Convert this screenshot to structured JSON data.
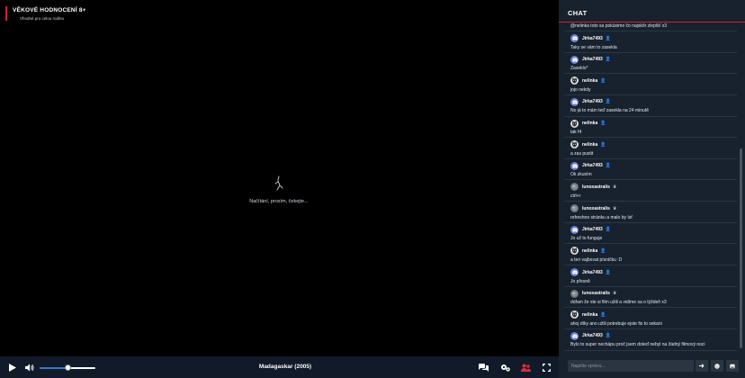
{
  "rating": {
    "title": "VĚKOVÉ HODNOCENÍ 8+",
    "subtitle": "Vhodné pro celou rodinu",
    "accent": "#d0202c"
  },
  "player": {
    "loading_text": "Načítání, prosím, čekejte...",
    "movie_title": "Madagaskar (2005)",
    "seek_progress": 0.5,
    "icons": [
      "play-icon",
      "volume-icon",
      "chat-icon",
      "settings-icon",
      "users-icon",
      "fullscreen-icon"
    ]
  },
  "chat": {
    "title": "CHAT",
    "first_text": "@nelinka toto sa pokúsime čo najskôr zlepšiť x3",
    "messages": [
      {
        "user": "Jirka7493",
        "avatar": "discord",
        "badge": "user",
        "text": "Taky se vám to zasekla"
      },
      {
        "user": "Jirka7493",
        "avatar": "discord",
        "badge": "user",
        "text": "Zaseklo*"
      },
      {
        "user": "nelinka",
        "avatar": "cat",
        "badge": "user",
        "text": "jojo nekdy"
      },
      {
        "user": "Jirka7493",
        "avatar": "discord",
        "badge": "user",
        "text": "No já to mám teď zasekla na 24 minutě"
      },
      {
        "user": "nelinka",
        "avatar": "cat",
        "badge": "user",
        "text": "tak f4"
      },
      {
        "user": "nelinka",
        "avatar": "cat",
        "badge": "user",
        "text": "a zas pustit"
      },
      {
        "user": "Jirka7493",
        "avatar": "discord",
        "badge": "user",
        "text": "Ok zkusím"
      },
      {
        "user": "lunoxastralis",
        "avatar": "astral",
        "badge": "crown",
        "text": "ctrl+r"
      },
      {
        "user": "lunoxastralis",
        "avatar": "astral",
        "badge": "crown",
        "text": "refreshne stránku a malo by ísť"
      },
      {
        "user": "Jirka7493",
        "avatar": "discord",
        "badge": "user",
        "text": "Jo už to funguje"
      },
      {
        "user": "nelinka",
        "avatar": "cat",
        "badge": "user",
        "text": "a ten vajbovat písničku :D"
      },
      {
        "user": "Jirka7493",
        "avatar": "discord",
        "badge": "user",
        "text": "Jo přesně"
      },
      {
        "user": "lunoxastralis",
        "avatar": "astral",
        "badge": "crown",
        "text": "dúfam že ste si film užili a vidíme sa o týždeň x3"
      },
      {
        "user": "nelinka",
        "avatar": "cat",
        "badge": "user",
        "text": "ahoj díky ano užili potrebuje ejste fix to sekani"
      },
      {
        "user": "Jirka7493",
        "avatar": "discord",
        "badge": "user",
        "text": "Bylo to super nechápu proč jsem doteď nebyl na žádný filmový noci"
      }
    ],
    "input_placeholder": "Napište zprávu...",
    "accent": "#cc2233"
  }
}
